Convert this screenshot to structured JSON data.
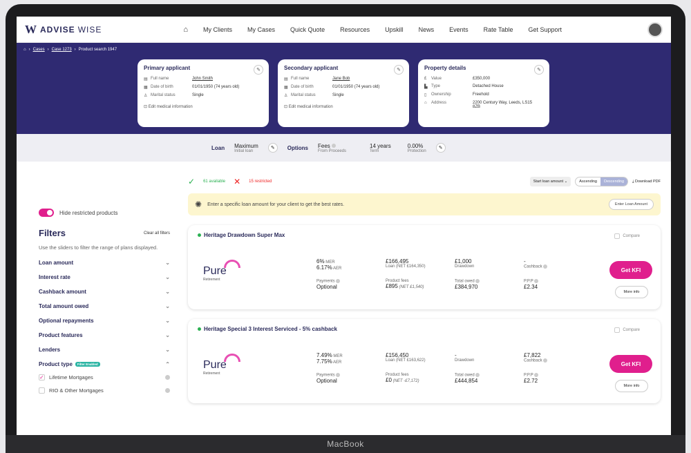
{
  "brand": {
    "name_a": "ADVISE",
    "name_b": "WISE",
    "mark": "W"
  },
  "nav": [
    "My Clients",
    "My Cases",
    "Quick Quote",
    "Resources",
    "Upskill",
    "News",
    "Events",
    "Rate Table",
    "Get Support"
  ],
  "breadcrumb": {
    "a": "Cases",
    "b": "Case 1273",
    "c": "Product search 1947"
  },
  "primary": {
    "title": "Primary applicant",
    "full_name_k": "Full name",
    "full_name_v": "John Smith",
    "dob_k": "Date of birth",
    "dob_v": "01/01/1950 (74 years old)",
    "ms_k": "Marital status",
    "ms_v": "Single",
    "med": "Edit medical information"
  },
  "secondary": {
    "title": "Secondary applicant",
    "full_name_k": "Full name",
    "full_name_v": "Jane Bob",
    "dob_k": "Date of birth",
    "dob_v": "01/01/1950 (74 years old)",
    "ms_k": "Marital status",
    "ms_v": "Single",
    "med": "Edit medical information"
  },
  "property": {
    "title": "Property details",
    "value_k": "Value",
    "value_v": "£350,000",
    "type_k": "Type",
    "type_v": "Detached House",
    "own_k": "Ownership",
    "own_v": "Freehold",
    "addr_k": "Address",
    "addr_v": "2200 Century Way, Leeds, LS15 8ZB"
  },
  "loanbar": {
    "loan": "Loan",
    "max": "Maximum",
    "max_sub": "Initial loan",
    "options": "Options",
    "fees": "Fees",
    "fees_sub": "From Proceeds",
    "term": "14 years",
    "term_sub": "Term",
    "prot": "0.00%",
    "prot_sub": "Protection"
  },
  "sidebar": {
    "toggle": "Hide restricted products",
    "filters": "Filters",
    "clear": "Clear all filters",
    "desc": "Use the sliders to filter the range of plans displayed.",
    "items": [
      "Loan amount",
      "Interest rate",
      "Cashback amount",
      "Total amount owed",
      "Optional repayments",
      "Product features",
      "Lenders"
    ],
    "ptype": "Product type",
    "badge": "Filter Enabled",
    "opt1": "Lifetime Mortgages",
    "opt2": "RIO & Other Mortgages"
  },
  "results": {
    "available": "61 available",
    "restricted": "15 restricted",
    "sort": "Start loan amount",
    "asc": "Ascending",
    "desc": "Descending",
    "pdf": "Download PDF",
    "tip": "Enter a specific loan amount for your client to get the best rates.",
    "tip_btn": "Enter Loan Amount"
  },
  "products": [
    {
      "name": "Heritage Drawdown Super Max",
      "compare": "Compare",
      "logo": "Pure",
      "logo_sub": "Retirement",
      "mer": "6%",
      "mer_u": "MER",
      "aer": "6.17%",
      "aer_u": "AER",
      "loan": "£166,495",
      "loan_sub": "Loan (NET £164,350)",
      "draw": "£1,000",
      "draw_sub": "Drawdown",
      "cash": "-",
      "cash_sub": "Cashback",
      "pay_k": "Payments",
      "pay_v": "Optional",
      "fees_k": "Product fees",
      "fees_v": "£895",
      "fees_net": "(NET £1,540)",
      "owed_k": "Total owed",
      "owed_v": "£384,970",
      "ppp_k": "P.P.P",
      "ppp_v": "£2.34",
      "kfi": "Get KFI",
      "more": "More info"
    },
    {
      "name": "Heritage Special 3 Interest Serviced - 5% cashback",
      "compare": "Compare",
      "logo": "Pure",
      "logo_sub": "Retirement",
      "mer": "7.49%",
      "mer_u": "MER",
      "aer": "7.75%",
      "aer_u": "AER",
      "loan": "£156,450",
      "loan_sub": "Loan (NET £163,622)",
      "draw": "-",
      "draw_sub": "Drawdown",
      "cash": "£7,822",
      "cash_sub": "Cashback",
      "pay_k": "Payments",
      "pay_v": "Optional",
      "fees_k": "Product fees",
      "fees_v": "£0",
      "fees_net": "(NET -£7,172)",
      "owed_k": "Total owed",
      "owed_v": "£444,854",
      "ppp_k": "P.P.P",
      "ppp_v": "£2.72",
      "kfi": "Get KFI",
      "more": "More info"
    }
  ],
  "device": "MacBook"
}
